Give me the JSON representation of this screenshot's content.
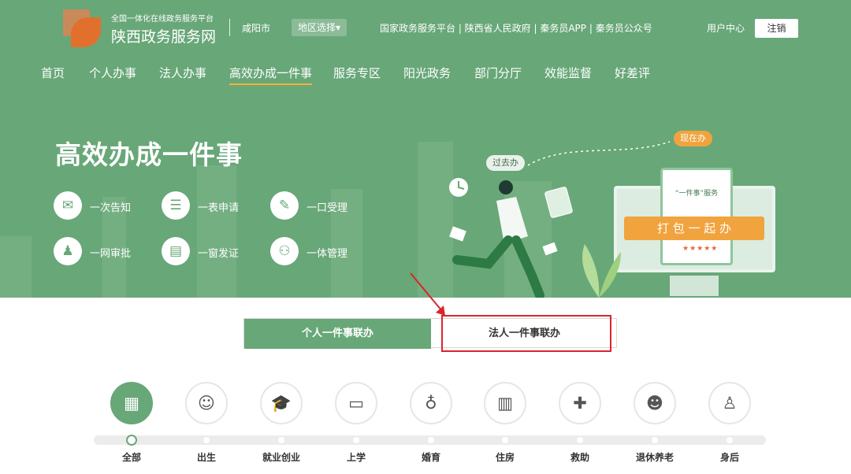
{
  "header": {
    "platform_sub": "全国一体化在线政务服务平台",
    "platform_title": "陕西政务服务网",
    "city": "咸阳市",
    "region_select": "地区选择▾",
    "links": "国家政务服务平台 | 陕西省人民政府 | 秦务员APP | 秦务员公众号",
    "user_center": "用户中心",
    "logout": "注销"
  },
  "nav": [
    "首页",
    "个人办事",
    "法人办事",
    "高效办成一件事",
    "服务专区",
    "阳光政务",
    "部门分厅",
    "效能监督",
    "好差评"
  ],
  "hero": {
    "title": "高效办成一件事",
    "features": [
      "一次告知",
      "一表申请",
      "一口受理",
      "一网审批",
      "一窗发证",
      "一体管理"
    ],
    "past_label": "过去办",
    "now_label": "现在办",
    "card_title": "“一件事”服务",
    "banner_text": "打 包 一 起 办",
    "stars": "★★★★★"
  },
  "tabs": [
    "个人一件事联办",
    "法人一件事联办"
  ],
  "categories": [
    "全部",
    "出生",
    "就业创业",
    "上学",
    "婚育",
    "住房",
    "救助",
    "退休养老",
    "身后"
  ],
  "colors": {
    "primary": "#68a778",
    "accent": "#f5b23d",
    "highlight": "#d9262b"
  }
}
